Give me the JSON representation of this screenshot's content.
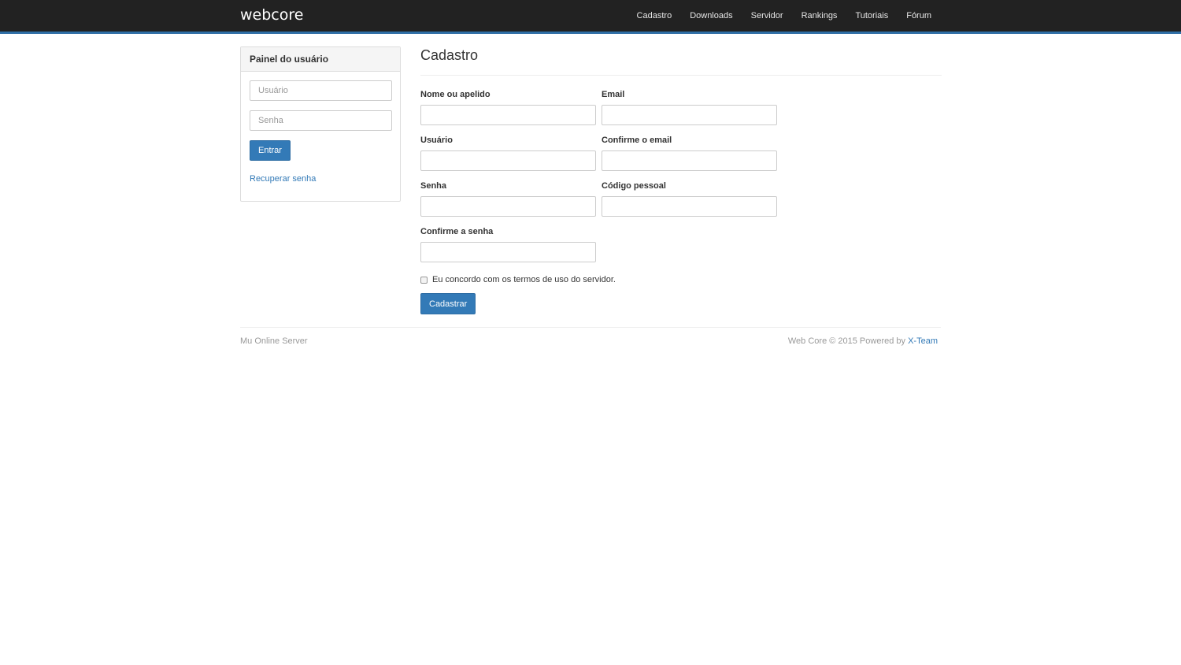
{
  "nav": {
    "brand": "webcore",
    "links": [
      "Cadastro",
      "Downloads",
      "Servidor",
      "Rankings",
      "Tutoriais",
      "Fórum"
    ]
  },
  "panel": {
    "title": "Painel do usuário",
    "username_placeholder": "Usuário",
    "password_placeholder": "Senha",
    "login_label": "Entrar",
    "recover_label": "Recuperar senha"
  },
  "form": {
    "title": "Cadastro",
    "fields": {
      "name_label": "Nome ou apelido",
      "email_label": "Email",
      "user_label": "Usuário",
      "confirm_email_label": "Confirme o email",
      "password_label": "Senha",
      "personal_code_label": "Código pessoal",
      "confirm_password_label": "Confirme a senha"
    },
    "terms_label": "Eu concordo com os termos de uso do servidor.",
    "submit_label": "Cadastrar"
  },
  "footer": {
    "left": "Mu Online Server",
    "right_prefix": "Web Core © 2015 Powered by",
    "right_link": "X-Team"
  },
  "colors": {
    "navbar": "#222222",
    "accent": "#337ab7",
    "nav_border": "#2f6fa6"
  }
}
